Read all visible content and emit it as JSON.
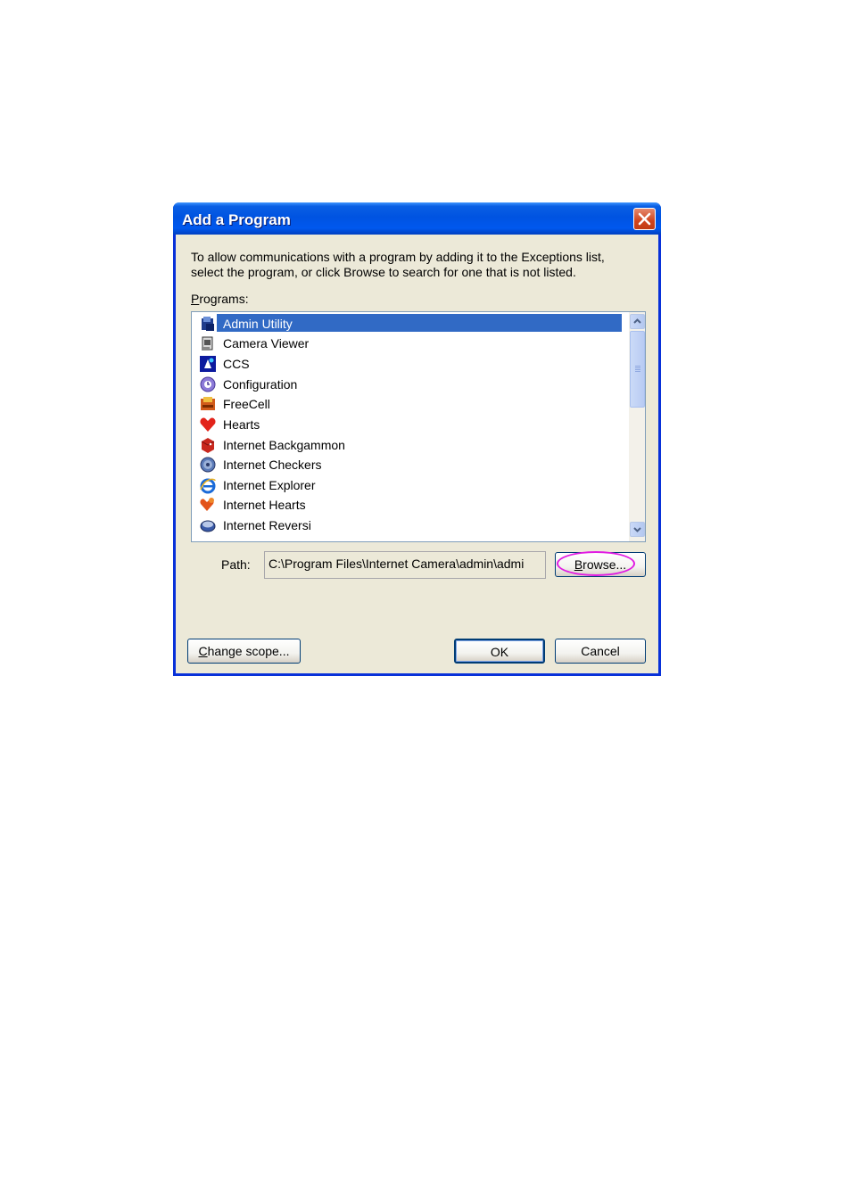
{
  "dialog": {
    "title": "Add a Program",
    "description": "To allow communications with a program by adding it to the Exceptions list, select the program, or click Browse to search for one that is not listed.",
    "programs_label_accel": "P",
    "programs_label_rest": "rograms:",
    "programs": [
      {
        "label": "Admin Utility",
        "icon": "admin-utility-icon",
        "selected": true
      },
      {
        "label": "Camera Viewer",
        "icon": "camera-viewer-icon"
      },
      {
        "label": "CCS",
        "icon": "ccs-icon"
      },
      {
        "label": "Configuration",
        "icon": "configuration-icon"
      },
      {
        "label": "FreeCell",
        "icon": "freecell-icon"
      },
      {
        "label": "Hearts",
        "icon": "hearts-icon"
      },
      {
        "label": "Internet Backgammon",
        "icon": "internet-backgammon-icon"
      },
      {
        "label": "Internet Checkers",
        "icon": "internet-checkers-icon"
      },
      {
        "label": "Internet Explorer",
        "icon": "internet-explorer-icon"
      },
      {
        "label": "Internet Hearts",
        "icon": "internet-hearts-icon"
      },
      {
        "label": "Internet Reversi",
        "icon": "internet-reversi-icon"
      }
    ],
    "path_label": "Path:",
    "path_value": "C:\\Program Files\\Internet Camera\\admin\\admi",
    "browse_accel": "B",
    "browse_rest": "rowse...",
    "change_scope_accel": "C",
    "change_scope_rest": "hange scope...",
    "ok_label": "OK",
    "cancel_label": "Cancel"
  }
}
